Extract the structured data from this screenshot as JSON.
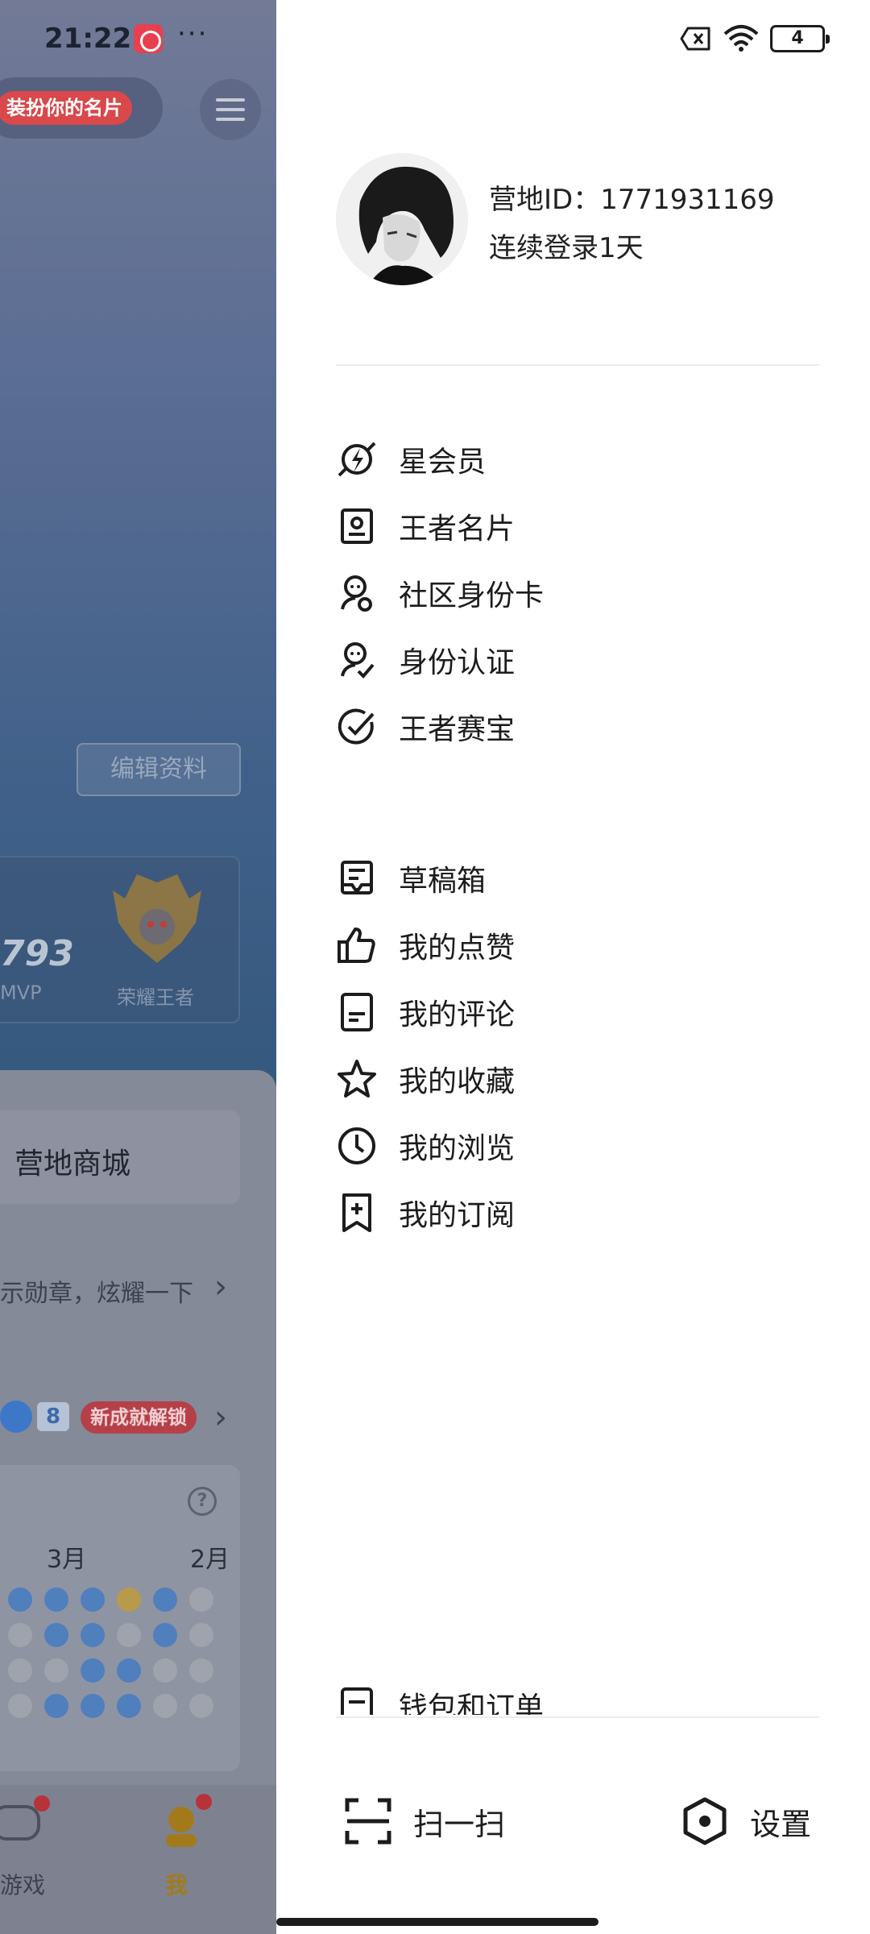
{
  "status_bar": {
    "time": "21:22",
    "more": "···",
    "battery_level": "4",
    "icons": [
      "app-notification-icon",
      "screen-record-off-icon",
      "wifi-icon",
      "battery-icon"
    ]
  },
  "background_page": {
    "dress_card_tag": "装扮你的名片",
    "edit_profile": "编辑资料",
    "stat_value": "793",
    "stat_label": "MVP",
    "rank_label": "荣耀王者",
    "mall_label": "营地商城",
    "medal_text": "示勋章，炫耀一下",
    "medal_count": "8",
    "unlock_tag": "新成就解锁",
    "months": [
      "3月",
      "2月"
    ],
    "tab_game": "游戏",
    "tab_me": "我"
  },
  "drawer": {
    "profile": {
      "camp_id": "营地ID：1771931169",
      "login_days": "连续登录1天"
    },
    "menu_group_1": [
      {
        "label": "星会员",
        "icon": "star-member-icon"
      },
      {
        "label": "王者名片",
        "icon": "name-card-icon"
      },
      {
        "label": "社区身份卡",
        "icon": "community-id-icon"
      },
      {
        "label": "身份认证",
        "icon": "identity-verify-icon"
      },
      {
        "label": "王者赛宝",
        "icon": "check-circle-icon"
      }
    ],
    "menu_group_2": [
      {
        "label": "草稿箱",
        "icon": "drafts-icon"
      },
      {
        "label": "我的点赞",
        "icon": "thumbs-up-icon"
      },
      {
        "label": "我的评论",
        "icon": "comment-doc-icon"
      },
      {
        "label": "我的收藏",
        "icon": "star-icon"
      },
      {
        "label": "我的浏览",
        "icon": "clock-icon"
      },
      {
        "label": "我的订阅",
        "icon": "bookmark-add-icon"
      }
    ],
    "menu_partial": {
      "label": "钱包和订单",
      "icon": "wallet-icon"
    },
    "bottom": {
      "scan": "扫一扫",
      "settings": "设置"
    }
  },
  "colors": {
    "accent_red": "#d9484a",
    "text_primary": "#1c1c1c",
    "drawer_bg": "#ffffff"
  }
}
